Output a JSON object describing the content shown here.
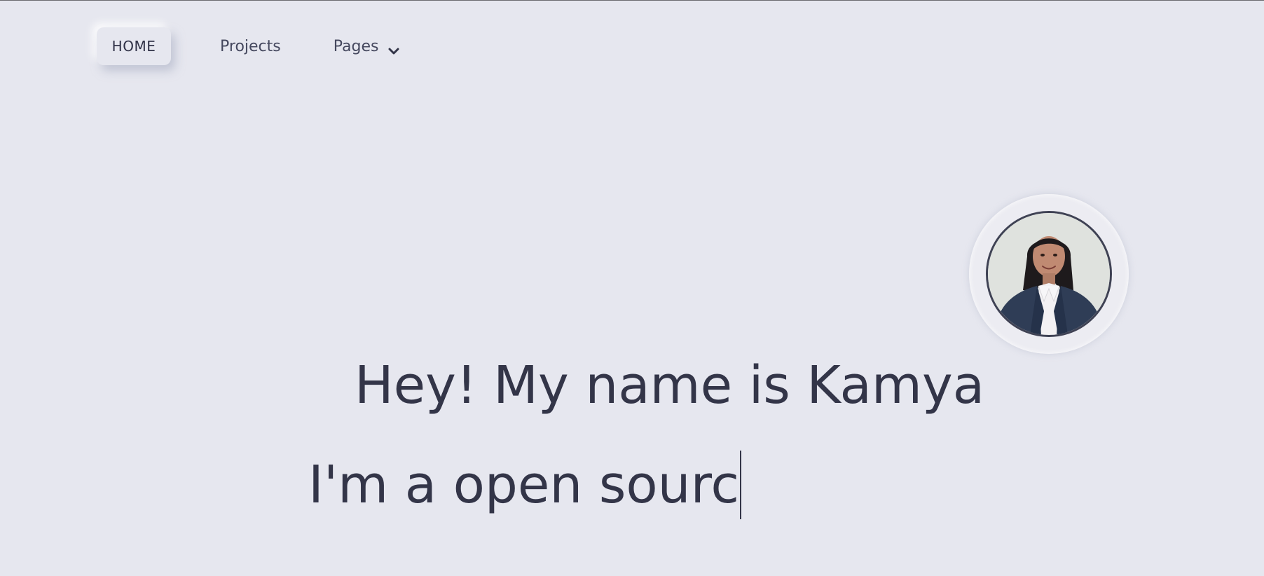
{
  "nav": {
    "home_label": "HOME",
    "projects_label": "Projects",
    "pages_label": "Pages"
  },
  "hero": {
    "title": "Hey! My name is Kamya",
    "typed_text": "I'm a open sourc"
  },
  "icons": {
    "pages_dropdown": "chevron-down-icon",
    "profile": "avatar"
  },
  "colors": {
    "background": "#e6e7ef",
    "text": "#333548"
  }
}
